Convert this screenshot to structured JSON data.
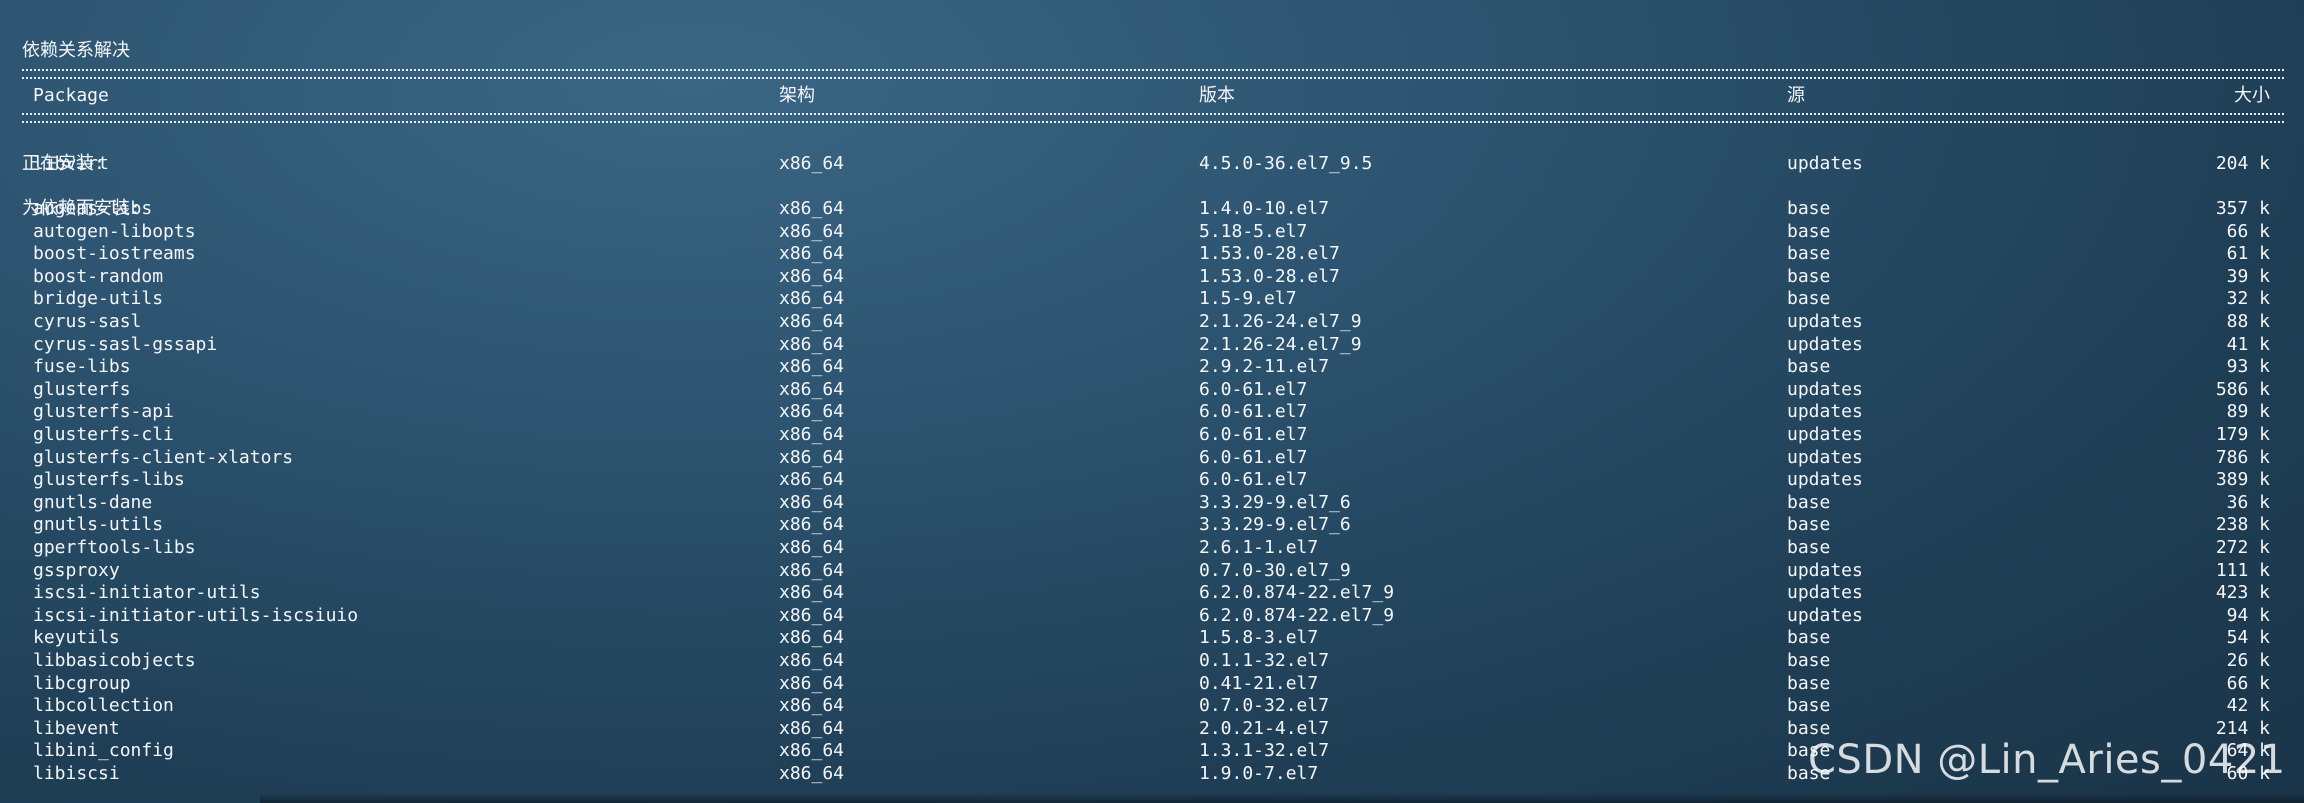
{
  "title": "依赖关系解决",
  "headers": {
    "package": "Package",
    "arch": "架构",
    "version": "版本",
    "repo": "源",
    "size": "大小"
  },
  "sections": {
    "installing": "正在安装:",
    "deps": "为依赖而安装:"
  },
  "main_package": {
    "name": "libvirt",
    "arch": "x86_64",
    "version": "4.5.0-36.el7_9.5",
    "repo": "updates",
    "size": "204 k"
  },
  "dep_packages": [
    {
      "name": "augeas-libs",
      "arch": "x86_64",
      "version": "1.4.0-10.el7",
      "repo": "base",
      "size": "357 k"
    },
    {
      "name": "autogen-libopts",
      "arch": "x86_64",
      "version": "5.18-5.el7",
      "repo": "base",
      "size": "66 k"
    },
    {
      "name": "boost-iostreams",
      "arch": "x86_64",
      "version": "1.53.0-28.el7",
      "repo": "base",
      "size": "61 k"
    },
    {
      "name": "boost-random",
      "arch": "x86_64",
      "version": "1.53.0-28.el7",
      "repo": "base",
      "size": "39 k"
    },
    {
      "name": "bridge-utils",
      "arch": "x86_64",
      "version": "1.5-9.el7",
      "repo": "base",
      "size": "32 k"
    },
    {
      "name": "cyrus-sasl",
      "arch": "x86_64",
      "version": "2.1.26-24.el7_9",
      "repo": "updates",
      "size": "88 k"
    },
    {
      "name": "cyrus-sasl-gssapi",
      "arch": "x86_64",
      "version": "2.1.26-24.el7_9",
      "repo": "updates",
      "size": "41 k"
    },
    {
      "name": "fuse-libs",
      "arch": "x86_64",
      "version": "2.9.2-11.el7",
      "repo": "base",
      "size": "93 k"
    },
    {
      "name": "glusterfs",
      "arch": "x86_64",
      "version": "6.0-61.el7",
      "repo": "updates",
      "size": "586 k"
    },
    {
      "name": "glusterfs-api",
      "arch": "x86_64",
      "version": "6.0-61.el7",
      "repo": "updates",
      "size": "89 k"
    },
    {
      "name": "glusterfs-cli",
      "arch": "x86_64",
      "version": "6.0-61.el7",
      "repo": "updates",
      "size": "179 k"
    },
    {
      "name": "glusterfs-client-xlators",
      "arch": "x86_64",
      "version": "6.0-61.el7",
      "repo": "updates",
      "size": "786 k"
    },
    {
      "name": "glusterfs-libs",
      "arch": "x86_64",
      "version": "6.0-61.el7",
      "repo": "updates",
      "size": "389 k"
    },
    {
      "name": "gnutls-dane",
      "arch": "x86_64",
      "version": "3.3.29-9.el7_6",
      "repo": "base",
      "size": "36 k"
    },
    {
      "name": "gnutls-utils",
      "arch": "x86_64",
      "version": "3.3.29-9.el7_6",
      "repo": "base",
      "size": "238 k"
    },
    {
      "name": "gperftools-libs",
      "arch": "x86_64",
      "version": "2.6.1-1.el7",
      "repo": "base",
      "size": "272 k"
    },
    {
      "name": "gssproxy",
      "arch": "x86_64",
      "version": "0.7.0-30.el7_9",
      "repo": "updates",
      "size": "111 k"
    },
    {
      "name": "iscsi-initiator-utils",
      "arch": "x86_64",
      "version": "6.2.0.874-22.el7_9",
      "repo": "updates",
      "size": "423 k"
    },
    {
      "name": "iscsi-initiator-utils-iscsiuio",
      "arch": "x86_64",
      "version": "6.2.0.874-22.el7_9",
      "repo": "updates",
      "size": "94 k"
    },
    {
      "name": "keyutils",
      "arch": "x86_64",
      "version": "1.5.8-3.el7",
      "repo": "base",
      "size": "54 k"
    },
    {
      "name": "libbasicobjects",
      "arch": "x86_64",
      "version": "0.1.1-32.el7",
      "repo": "base",
      "size": "26 k"
    },
    {
      "name": "libcgroup",
      "arch": "x86_64",
      "version": "0.41-21.el7",
      "repo": "base",
      "size": "66 k"
    },
    {
      "name": "libcollection",
      "arch": "x86_64",
      "version": "0.7.0-32.el7",
      "repo": "base",
      "size": "42 k"
    },
    {
      "name": "libevent",
      "arch": "x86_64",
      "version": "2.0.21-4.el7",
      "repo": "base",
      "size": "214 k"
    },
    {
      "name": "libini_config",
      "arch": "x86_64",
      "version": "1.3.1-32.el7",
      "repo": "base",
      "size": "64 k"
    },
    {
      "name": "libiscsi",
      "arch": "x86_64",
      "version": "1.9.0-7.el7",
      "repo": "base",
      "size": "60 k"
    }
  ],
  "watermark": "CSDN @Lin_Aries_0421"
}
